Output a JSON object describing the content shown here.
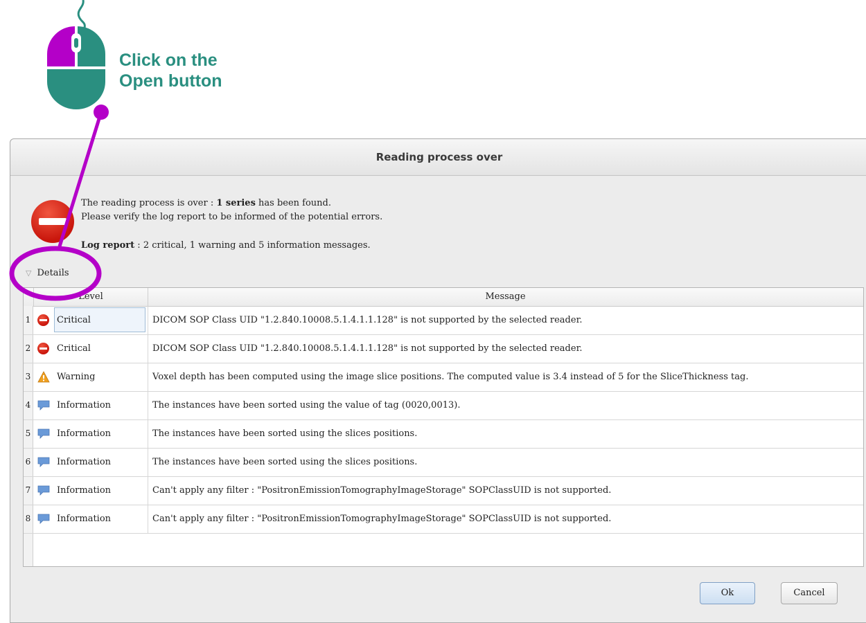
{
  "annotation": {
    "instruction": "Click on the\nOpen button",
    "line1": "Click on the",
    "line2": "Open button"
  },
  "dialog": {
    "title": "Reading process over",
    "message_line1_prefix": "The reading process is over : ",
    "message_line1_bold": "1 series",
    "message_line1_suffix": " has been found.",
    "message_line2": "Please verify the log report to be informed of the potential errors.",
    "log_report_label": "Log report",
    "log_report_text": " : 2 critical, 1 warning and 5 information messages.",
    "details_label": "Details",
    "ok_label": "Ok",
    "cancel_label": "Cancel"
  },
  "table": {
    "columns": [
      "Level",
      "Message"
    ],
    "rows": [
      {
        "num": "1",
        "icon": "critical-icon",
        "level": "Critical",
        "message": "DICOM SOP Class UID \"1.2.840.10008.5.1.4.1.1.128\" is not supported by the selected reader."
      },
      {
        "num": "2",
        "icon": "critical-icon",
        "level": "Critical",
        "message": "DICOM SOP Class UID \"1.2.840.10008.5.1.4.1.1.128\" is not supported by the selected reader."
      },
      {
        "num": "3",
        "icon": "warning-icon",
        "level": "Warning",
        "message": "Voxel depth has been computed using the image slice positions. The computed value is 3.4 instead of 5 for the SliceThickness tag."
      },
      {
        "num": "4",
        "icon": "information-icon",
        "level": "Information",
        "message": "The instances have been sorted using the value of tag (0020,0013)."
      },
      {
        "num": "5",
        "icon": "information-icon",
        "level": "Information",
        "message": "The instances have been sorted using the slices positions."
      },
      {
        "num": "6",
        "icon": "information-icon",
        "level": "Information",
        "message": "The instances have been sorted using the slices positions."
      },
      {
        "num": "7",
        "icon": "information-icon",
        "level": "Information",
        "message": "Can't apply any filter : \"PositronEmissionTomographyImageStorage\" SOPClassUID is not supported."
      },
      {
        "num": "8",
        "icon": "information-icon",
        "level": "Information",
        "message": "Can't apply any filter : \"PositronEmissionTomographyImageStorage\" SOPClassUID is not supported."
      }
    ]
  },
  "colors": {
    "annotation_teal": "#2a8f80",
    "annotation_purple": "#b400c8",
    "critical_red": "#d0200f",
    "warning_orange": "#f0a020",
    "info_blue": "#6a9ad8"
  }
}
